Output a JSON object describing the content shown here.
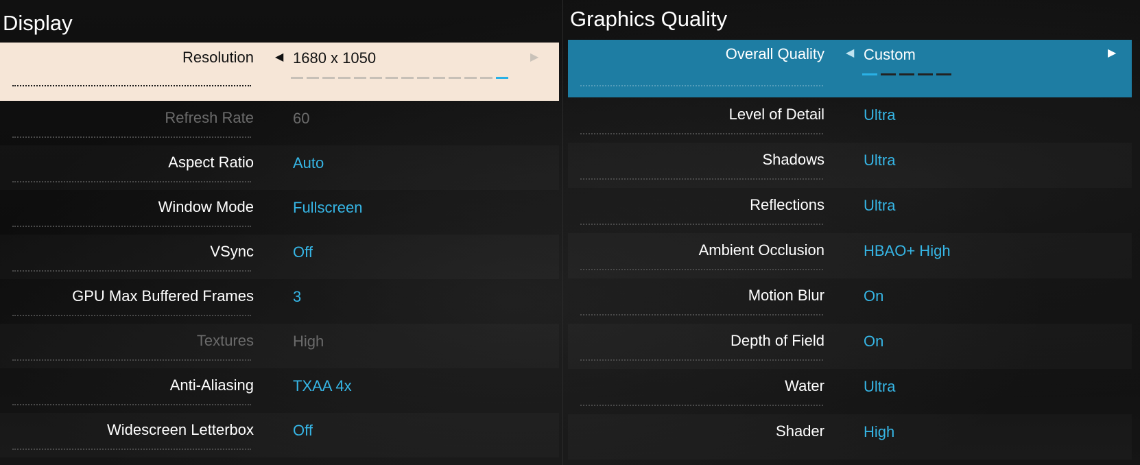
{
  "display": {
    "title": "Display",
    "rows": [
      {
        "label": "Resolution",
        "value": "1680 x 1050"
      },
      {
        "label": "Refresh Rate",
        "value": "60"
      },
      {
        "label": "Aspect Ratio",
        "value": "Auto"
      },
      {
        "label": "Window Mode",
        "value": "Fullscreen"
      },
      {
        "label": "VSync",
        "value": "Off"
      },
      {
        "label": "GPU Max Buffered Frames",
        "value": "3"
      },
      {
        "label": "Textures",
        "value": "High"
      },
      {
        "label": "Anti-Aliasing",
        "value": "TXAA 4x"
      },
      {
        "label": "Widescreen Letterbox",
        "value": "Off"
      }
    ],
    "resolution_slider": {
      "steps": 14,
      "selected_step": 14
    },
    "disabled_rows": [
      "Refresh Rate",
      "Textures"
    ]
  },
  "graphics": {
    "title": "Graphics Quality",
    "rows": [
      {
        "label": "Overall Quality",
        "value": "Custom"
      },
      {
        "label": "Level of Detail",
        "value": "Ultra"
      },
      {
        "label": "Shadows",
        "value": "Ultra"
      },
      {
        "label": "Reflections",
        "value": "Ultra"
      },
      {
        "label": "Ambient Occlusion",
        "value": "HBAO+ High"
      },
      {
        "label": "Motion Blur",
        "value": "On"
      },
      {
        "label": "Depth of Field",
        "value": "On"
      },
      {
        "label": "Water",
        "value": "Ultra"
      },
      {
        "label": "Shader",
        "value": "High"
      }
    ],
    "overall_slider": {
      "steps": 5,
      "selected_step": 1
    }
  },
  "icons": {
    "left_arrow": "triangle-left-icon",
    "right_arrow": "triangle-right-icon"
  },
  "colors": {
    "accent": "#36b6e6",
    "selected_left_bg": "#f6e6d7",
    "selected_right_bg": "#1e7da3",
    "disabled_text": "#6b6b6b"
  }
}
